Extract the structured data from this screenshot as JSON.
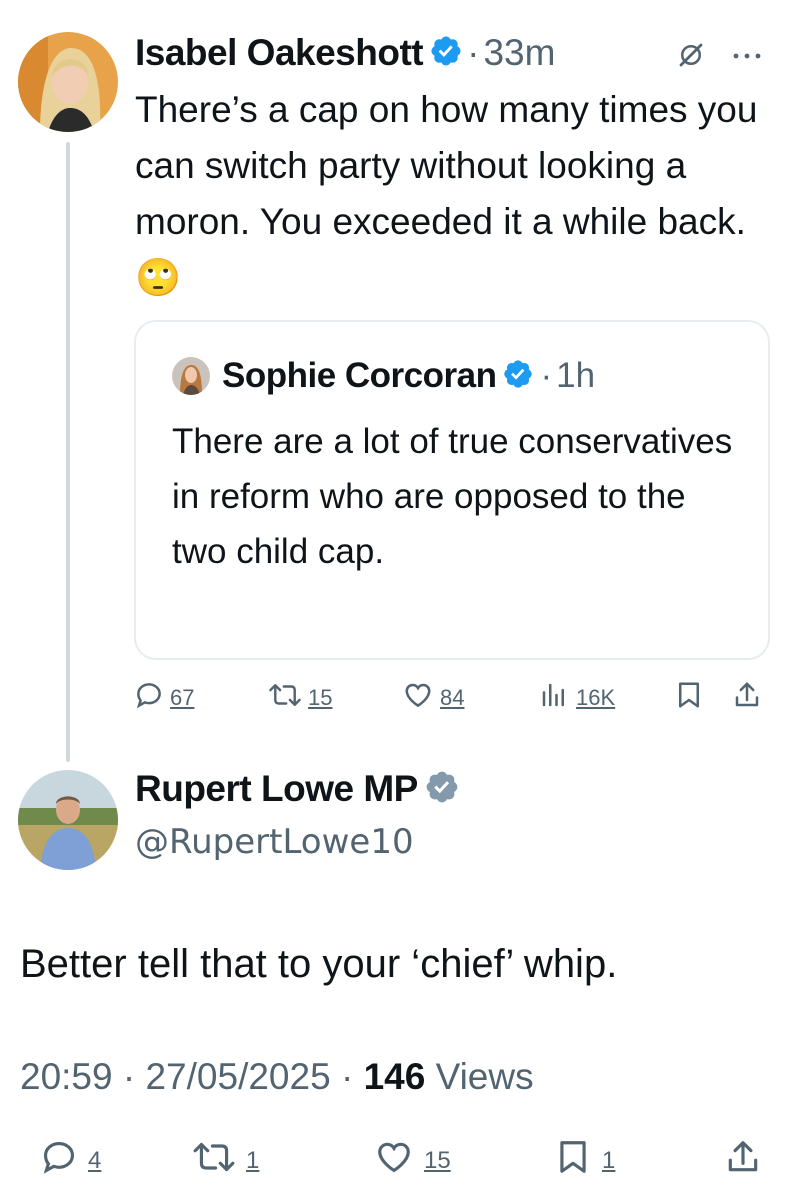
{
  "parent_tweet": {
    "author_name": "Isabel Oakeshott",
    "separator": "·",
    "time": "33m",
    "text": "There’s a cap on how many times you can switch party without looking a moron. You exceeded it a while back. 🙄",
    "icons": {
      "verified": "verified-badge-icon",
      "grok": "grok-icon",
      "more": "more-icon"
    },
    "quote": {
      "author_name": "Sophie Corcoran",
      "separator": "·",
      "time": "1h",
      "text": "There are a lot of true conservatives in reform who are opposed to the two child cap."
    },
    "actions": {
      "replies": "67",
      "reposts": "15",
      "likes": "84",
      "views": "16K"
    }
  },
  "reply_tweet": {
    "author_name": "Rupert Lowe MP",
    "handle": "@RupertLowe10",
    "text": "Better tell that to your ‘chief’ whip.",
    "time": "20:59",
    "date": "27/05/2025",
    "separator": "·",
    "views_count": "146",
    "views_label": "Views",
    "actions": {
      "replies": "4",
      "reposts": "1",
      "likes": "15",
      "bookmarks": "1"
    }
  },
  "colors": {
    "verified_blue": "#1d9bf0",
    "verified_gray": "#829aab",
    "secondary_text": "#536471",
    "thread_line": "#cfd9de"
  }
}
